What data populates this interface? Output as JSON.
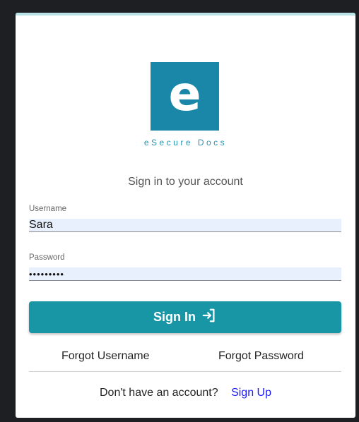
{
  "logo": {
    "letter": "e",
    "brand_name": "eSecure Docs",
    "color": "#1b87a8"
  },
  "subtitle": "Sign in to your account",
  "username": {
    "label": "Username",
    "value": "Sara"
  },
  "password": {
    "label": "Password",
    "value": "•••••••••"
  },
  "sign_in": {
    "label": "Sign In",
    "icon": "login-arrow-icon",
    "color": "#1896a6"
  },
  "links": {
    "forgot_username": "Forgot Username",
    "forgot_password": "Forgot Password"
  },
  "signup": {
    "prompt": "Don't have an account?",
    "link": "Sign Up"
  }
}
